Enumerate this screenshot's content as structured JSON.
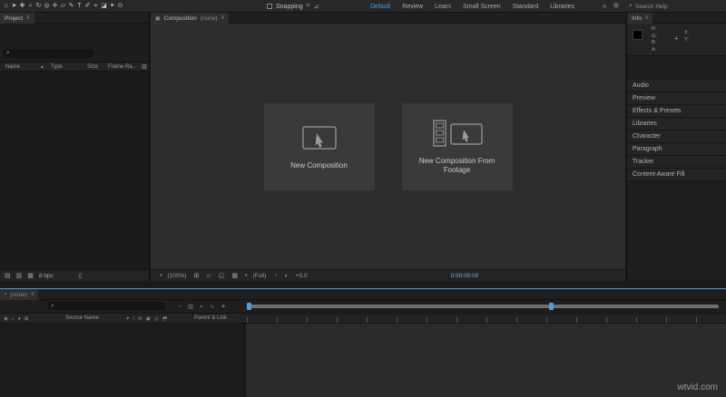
{
  "colors": {
    "accent": "#4c9fe0"
  },
  "topbar": {
    "tools": [
      {
        "name": "home-icon",
        "glyph": "⌂"
      },
      {
        "name": "selection-tool-icon",
        "glyph": "➤"
      },
      {
        "name": "hand-tool-icon",
        "glyph": "✥"
      },
      {
        "name": "zoom-tool-icon",
        "glyph": "⌕"
      },
      {
        "name": "rotation-tool-icon",
        "glyph": "↻"
      },
      {
        "name": "orbit-camera-tool-icon",
        "glyph": "◎"
      },
      {
        "name": "pan-behind-tool-icon",
        "glyph": "✛"
      },
      {
        "name": "mask-shape-tool-icon",
        "glyph": "▱"
      },
      {
        "name": "pen-tool-icon",
        "glyph": "✎"
      },
      {
        "name": "type-tool-icon",
        "glyph": "T"
      },
      {
        "name": "brush-tool-icon",
        "glyph": "✐"
      },
      {
        "name": "clone-stamp-tool-icon",
        "glyph": "⌖"
      },
      {
        "name": "eraser-tool-icon",
        "glyph": "◪"
      },
      {
        "name": "roto-brush-tool-icon",
        "glyph": "✦"
      },
      {
        "name": "puppet-pin-tool-icon",
        "glyph": "⊙"
      }
    ],
    "snapping": {
      "label": "Snapping"
    },
    "snapping_icons": [
      {
        "name": "snapping-feature-icon",
        "glyph": "⌗"
      },
      {
        "name": "snapping-range-icon",
        "glyph": "⊿"
      }
    ],
    "workspaces": [
      {
        "label": "Default",
        "active": true
      },
      {
        "label": "Review",
        "active": false
      },
      {
        "label": "Learn",
        "active": false
      },
      {
        "label": "Small Screen",
        "active": false
      },
      {
        "label": "Standard",
        "active": false
      },
      {
        "label": "Libraries",
        "active": false
      }
    ],
    "overflow_glyph": "»",
    "panel_icon_glyph": "⊞",
    "search": {
      "icon_glyph": "⌕",
      "placeholder": "Search Help"
    }
  },
  "project": {
    "tab_label": "Project",
    "menu_glyph": "≡",
    "search_icon_glyph": "⌕",
    "columns": {
      "name": "Name",
      "sort_glyph": "▲",
      "type": "Type",
      "size": "Size",
      "frame_rate": "Frame Ra.."
    },
    "column_options_glyph": "▥",
    "footer": {
      "icons": [
        {
          "name": "interpret-footage-icon",
          "glyph": "▤"
        },
        {
          "name": "new-folder-icon",
          "glyph": "▥"
        },
        {
          "name": "new-composition-icon",
          "glyph": "▦"
        }
      ],
      "bpc": "8 bpc",
      "trash_glyph": "▯"
    }
  },
  "composition": {
    "tab_icon_glyph": "▣",
    "tab_label": "Composition",
    "tab_state": "(none)",
    "menu_glyph": "≡",
    "cards": [
      {
        "label": "New Composition"
      },
      {
        "label": "New Composition From Footage"
      }
    ],
    "status": {
      "caret": "▾",
      "zoom": "(100%)",
      "icons": [
        {
          "name": "grid-and-guides-icon",
          "glyph": "⊞"
        },
        {
          "name": "mask-visibility-icon",
          "glyph": "▱"
        },
        {
          "name": "region-of-interest-icon",
          "glyph": "◱"
        },
        {
          "name": "transparency-grid-icon",
          "glyph": "▦"
        }
      ],
      "resolution": "(Full)",
      "camera_icons": [
        {
          "name": "active-camera-icon",
          "glyph": "◔"
        },
        {
          "name": "exposure-icon",
          "glyph": "◐"
        }
      ],
      "exposure": "+0.0",
      "timecode": "0:00:00:00"
    }
  },
  "info": {
    "tab_label": "Info",
    "menu_glyph": "≡",
    "channels": [
      "R:",
      "G:",
      "B:",
      "A:"
    ],
    "crosshair": "+",
    "axes": [
      "X:",
      "Y:"
    ],
    "sections": [
      "Audio",
      "Preview",
      "Effects & Presets",
      "Libraries",
      "Character",
      "Paragraph",
      "Tracker",
      "Content-Aware Fill"
    ]
  },
  "timeline": {
    "tab_icon_glyph": "▪",
    "tab_label": "(none)",
    "menu_glyph": "≡",
    "search_icon_glyph": "⌕",
    "toggle_icons": [
      {
        "name": "quality-toggle-icon",
        "glyph": "◔"
      },
      {
        "name": "frame-blending-icon",
        "glyph": "▥"
      },
      {
        "name": "motion-blur-icon",
        "glyph": "◗"
      },
      {
        "name": "graph-editor-icon",
        "glyph": "∿"
      },
      {
        "name": "draft-3d-icon",
        "glyph": "✦"
      }
    ],
    "left_icons": [
      {
        "name": "video-eye-icon",
        "glyph": "◉"
      },
      {
        "name": "audio-icon",
        "glyph": "♪"
      },
      {
        "name": "solo-icon",
        "glyph": "●"
      },
      {
        "name": "lock-icon",
        "glyph": "⊠"
      }
    ],
    "columns": {
      "source_name": "Source Name",
      "parent_link": "Parent & Link"
    },
    "switch_icons": [
      {
        "name": "shy-layer-icon",
        "glyph": "✦"
      },
      {
        "name": "collapse-transformations-icon",
        "glyph": "\\"
      },
      {
        "name": "effects-icon",
        "glyph": "fx"
      },
      {
        "name": "frame-blend-icon",
        "glyph": "▣"
      },
      {
        "name": "motion-blur-switch-icon",
        "glyph": "◎"
      },
      {
        "name": "3d-layer-icon",
        "glyph": "⬒"
      }
    ]
  },
  "watermark": "wtvid.com"
}
